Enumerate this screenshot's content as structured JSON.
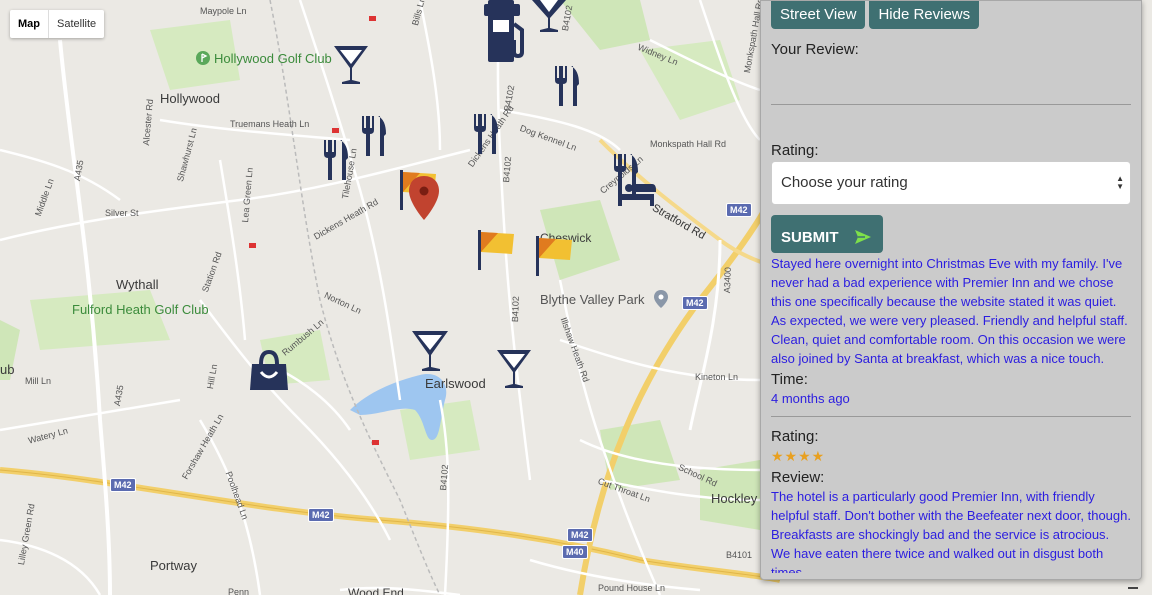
{
  "map": {
    "type_control": {
      "map_label": "Map",
      "satellite_label": "Satellite"
    },
    "towns": {
      "hollywood": "Hollywood",
      "wythall": "Wythall",
      "earlswood": "Earlswood",
      "portway": "Portway",
      "hockley": "Hockley",
      "cheswick": "Cheswick",
      "wood_end": "Wood End",
      "ub": "ub"
    },
    "pois": {
      "hollywood_golf": "Hollywood Golf Club",
      "fulford_heath_golf": "Fulford Heath Golf Club",
      "blythe_valley": "Blythe Valley Park"
    },
    "roads": {
      "maypole": "Maypole Ln",
      "bills": "Bills Ln",
      "widney": "Widney Ln",
      "monkspath": "Monkspath Hall Rd",
      "monkspath2": "Monkspath Hall Rd",
      "alcester": "Alcester Rd",
      "truemans": "Truemans Heath Ln",
      "shawhurst": "Shawhurst Ln",
      "dickens": "Dickens Heath Rd",
      "dickens2": "Dickens Heath Rd",
      "tilehouse": "Tilehouse Ln",
      "dog_kennel": "Dog Kennel Ln",
      "lea_green": "Lea Green Ln",
      "middle": "Middle Ln",
      "silver": "Silver St",
      "station": "Station Rd",
      "norton": "Norton Ln",
      "rumbush": "Rumbush Ln",
      "mill": "Mill Ln",
      "hill": "Hill Ln",
      "watery": "Watery Ln",
      "forshaw": "Forshaw Heath Ln",
      "poolhead": "Poolhead Ln",
      "illshaw": "Illshaw Heath Rd",
      "kineton": "Kineton Ln",
      "school": "School Rd",
      "cut_throat": "Cut Throat Ln",
      "pound_house": "Pound House Ln",
      "lilley": "Lilley Green Rd",
      "stratford": "Stratford Rd",
      "creynolds": "Creynolds Ln",
      "penn": "Penn"
    },
    "shields": {
      "a435_1": "A435",
      "a435_2": "A435",
      "b4102_1": "B4102",
      "b4102_2": "B4102",
      "b4102_3": "B4102",
      "b4102_4": "B4102",
      "b4102_5": "B4102",
      "a3400": "A3400",
      "m42_1": "M42",
      "m42_2": "M42",
      "m42_3": "M42",
      "m42_4": "M42",
      "m42_5": "M42",
      "m40": "M40",
      "b4101": "B4101"
    }
  },
  "panel": {
    "street_view_label": "Street View",
    "hide_reviews_label": "Hide Reviews",
    "your_review_label": "Your Review:",
    "your_review_value": "",
    "rating_label": "Rating:",
    "rating_select_value": "Choose your rating",
    "submit_label": "SUBMIT",
    "reviews": [
      {
        "review_text": "Stayed here overnight into Christmas Eve with my family. I've never had a bad experience with Premier Inn and we chose this one specifically because the website stated it was quiet. As expected, we were very pleased. Friendly and helpful staff. Clean, quiet and comfortable room. On this occasion we were also joined by Santa at breakfast, which was a nice touch.",
        "time_label": "Time:",
        "time_value": "4 months ago"
      },
      {
        "rating_label": "Rating:",
        "stars": "★★★★",
        "star_count": 4,
        "review_label": "Review:",
        "review_text": "The hotel is a particularly good Premier Inn, with friendly helpful staff. Don't bother with the Beefeater next door, though. Breakfasts are shockingly bad and the service is atrocious. We have eaten there twice and walked out in disgust both times."
      }
    ]
  },
  "colors": {
    "button_teal": "#3f7072",
    "review_text_blue": "#2b1de0",
    "star_gold": "#e8a020",
    "marker_navy": "#26335a",
    "pin_red": "#c1432f"
  }
}
